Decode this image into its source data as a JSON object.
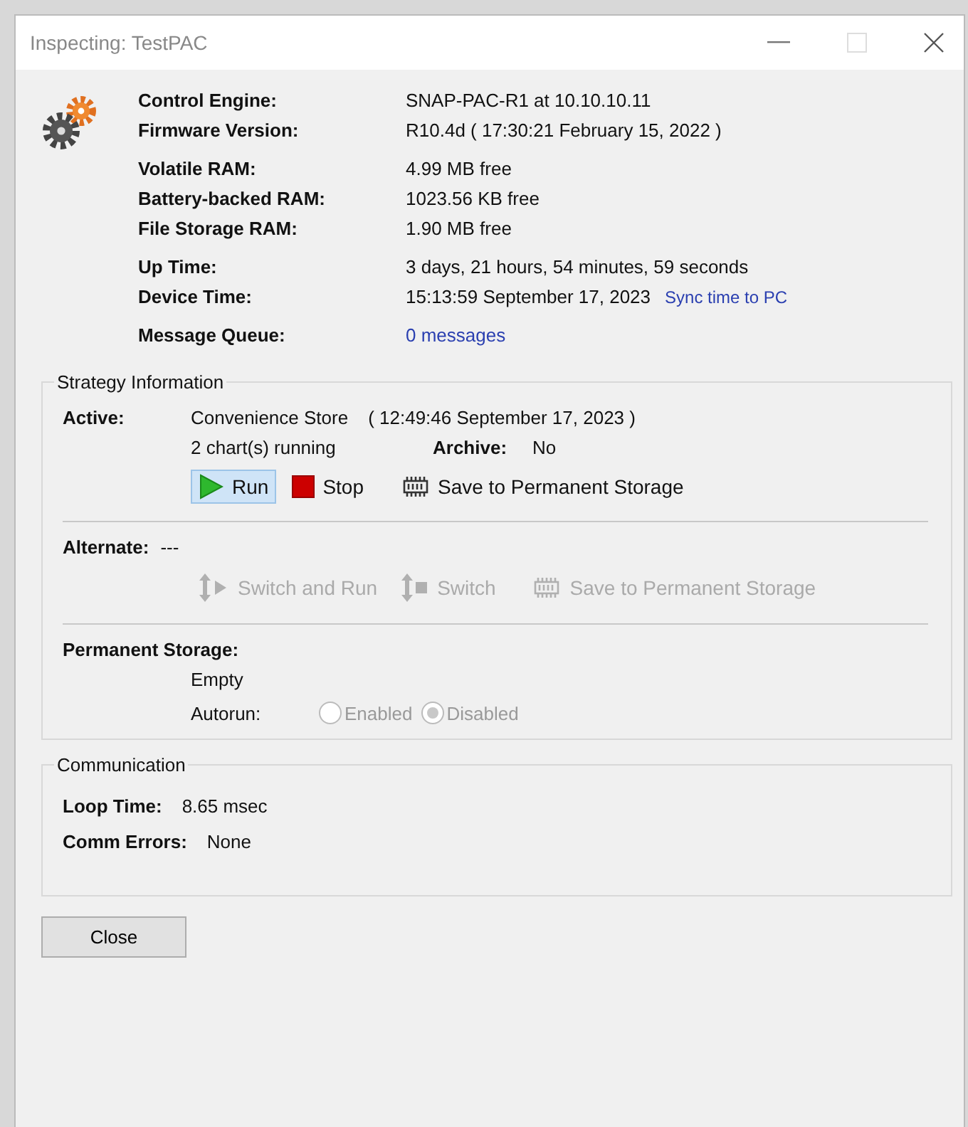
{
  "window": {
    "title": "Inspecting:  TestPAC"
  },
  "info_groups": [
    [
      {
        "label": "Control Engine:",
        "value": "SNAP-PAC-R1 at 10.10.10.11"
      },
      {
        "label": "Firmware Version:",
        "value": "R10.4d    ( 17:30:21  February 15, 2022 )"
      }
    ],
    [
      {
        "label": "Volatile RAM:",
        "value": "4.99 MB free"
      },
      {
        "label": "Battery-backed RAM:",
        "value": "1023.56 KB free"
      },
      {
        "label": "File Storage RAM:",
        "value": "1.90 MB free"
      }
    ],
    [
      {
        "label": "Up Time:",
        "value": "3 days, 21 hours, 54 minutes, 59 seconds"
      },
      {
        "label": "Device Time:",
        "value": "15:13:59  September 17, 2023",
        "link": "Sync time to PC"
      }
    ],
    [
      {
        "label": "Message Queue:",
        "value": "0 messages",
        "kind": "link"
      }
    ]
  ],
  "strategy": {
    "title": "Strategy Information",
    "active": {
      "label": "Active:",
      "name": "Convenience Store",
      "timestamp": "( 12:49:46  September 17, 2023 )",
      "charts": "2 chart(s) running",
      "archive_label": "Archive:",
      "archive_value": "No",
      "buttons": [
        {
          "kind": "run",
          "label": "Run",
          "selected": true,
          "disabled": false
        },
        {
          "kind": "stop",
          "label": "Stop",
          "selected": false,
          "disabled": false
        },
        {
          "kind": "save",
          "label": "Save to Permanent Storage",
          "selected": false,
          "disabled": false
        }
      ]
    },
    "alternate": {
      "label": "Alternate:",
      "value": "---",
      "buttons": [
        {
          "kind": "switch-run",
          "label": "Switch and Run",
          "selected": false,
          "disabled": true
        },
        {
          "kind": "switch",
          "label": "Switch",
          "selected": false,
          "disabled": true
        },
        {
          "kind": "save",
          "label": "Save to Permanent Storage",
          "selected": false,
          "disabled": true
        }
      ]
    },
    "permanent": {
      "label": "Permanent Storage:",
      "value": "Empty",
      "autorun_label": "Autorun:",
      "options": [
        {
          "label": "Enabled",
          "selected": false,
          "disabled": true
        },
        {
          "label": "Disabled",
          "selected": true,
          "disabled": true
        }
      ]
    }
  },
  "communication": {
    "title": "Communication",
    "rows": [
      {
        "label": "Loop Time:",
        "value": "8.65 msec"
      },
      {
        "label": "Comm Errors:",
        "value": "None"
      }
    ]
  },
  "close_button": "Close"
}
